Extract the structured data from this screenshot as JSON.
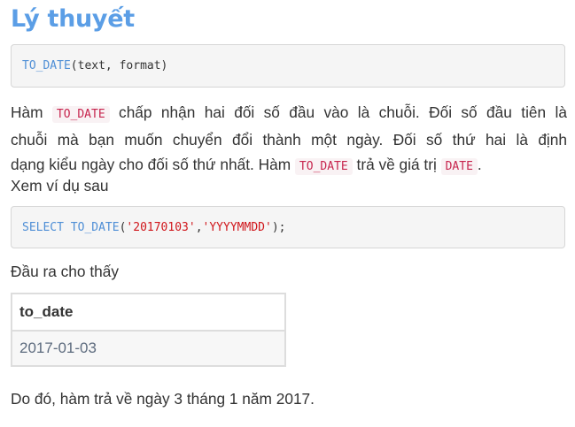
{
  "heading": "Lý thuyết",
  "syntax": {
    "fn": "TO_DATE",
    "args": "(text, format)"
  },
  "desc": {
    "t1": "Hàm ",
    "c1": "TO_DATE",
    "t2": " chấp nhận hai đối số đầu vào là chuỗi. Đối số đầu tiên là",
    "t3": "chuỗi mà bạn muốn chuyển đổi thành một ngày. Đối số thứ hai là định",
    "t4": "dạng kiểu ngày cho đối số thứ nhất. Hàm ",
    "c2": "TO_DATE",
    "t5": " trả về giá trị ",
    "c3": "DATE",
    "t6": "."
  },
  "example_intro": "Xem ví dụ sau",
  "example_sql": {
    "kw_select": "SELECT",
    "space": " ",
    "fn": "TO_DATE",
    "open": "(",
    "arg1": "'20170103'",
    "comma": ",",
    "arg2": "'YYYYMMDD'",
    "close": ");"
  },
  "output_intro": "Đầu ra cho thấy",
  "result_table": {
    "header": "to_date",
    "value": "2017-01-03"
  },
  "conclusion": "Do đó, hàm trả về ngày 3 tháng 1 năm 2017."
}
